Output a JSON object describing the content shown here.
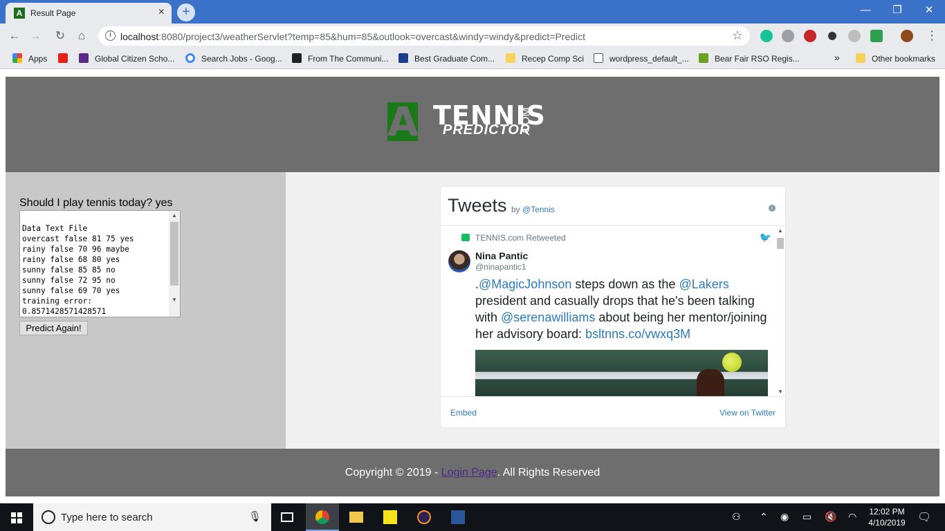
{
  "browser": {
    "tab_title": "Result Page",
    "tab_favicon_letter": "A",
    "tab_close": "×",
    "new_tab": "+",
    "window_controls": {
      "minimize": "—",
      "restore": "❐",
      "close": "✕"
    },
    "url_host": "localhost",
    "url_rest": ":8080/project3/weatherServlet?temp=85&hum=85&outlook=overcast&windy=windy&predict=Predict",
    "nav": {
      "back": "←",
      "forward": "→",
      "reload": "↻",
      "home": "⌂"
    },
    "star": "☆",
    "menu": "⋮"
  },
  "bookmarks": {
    "items": [
      {
        "label": "Apps",
        "color": "#e94235"
      },
      {
        "label": "Global Citizen Scho...",
        "color": "#5b2a86"
      },
      {
        "label": "Search Jobs - Goog...",
        "color": "#4285f4"
      },
      {
        "label": "From The Communi...",
        "color": "#222222"
      },
      {
        "label": "Best Graduate Com...",
        "color": "#1a3e8c"
      },
      {
        "label": "Recep Comp Sci",
        "color": "#f7d358"
      },
      {
        "label": "wordpress_default_...",
        "color": "#ffffff"
      },
      {
        "label": "Bear Fair RSO Regis...",
        "color": "#6aa121"
      }
    ],
    "overflow": "»",
    "other": "Other bookmarks"
  },
  "site": {
    "logo": {
      "letter": "A",
      "tennis": "TENNIS",
      "predictor": "PREDICTOR",
      "com": ".COM",
      "green": "#1a7a1a"
    },
    "question": "Should I play tennis today? yes",
    "result_text": "Data Text File\novercast false 81 75 yes\nrainy false 70 96 maybe\nrainy false 68 80 yes\nsunny false 85 85 no\nsunny false 72 95 no\nsunny false 69 70 yes\ntraining error:\n0.8571428571428571",
    "predict_button": "Predict Again!",
    "footer_prefix": "Copyright © 2019 - ",
    "footer_link": "Login Page",
    "footer_suffix": ". All Rights Reserved"
  },
  "twitter": {
    "title": "Tweets",
    "by": "by ",
    "by_handle": "@Tennis",
    "info": "i",
    "retweet_label": "TENNIS.com Retweeted",
    "author_name": "Nina Pantic",
    "author_handle": "@ninapantic1",
    "tweet": {
      "t0": ".",
      "m1": "@MagicJohnson",
      "t1": " steps down as the ",
      "m2": "@Lakers",
      "t2": " president and casually drops that he's been talking with ",
      "m3": "@serenawilliams",
      "t3": " about being her mentor/joining her advisory board: ",
      "link": "bsltnns.co/vwxq3M"
    },
    "embed": "Embed",
    "view_on": "View on Twitter"
  },
  "taskbar": {
    "search_placeholder": "Type here to search",
    "time": "12:02 PM",
    "date": "4/10/2019"
  }
}
